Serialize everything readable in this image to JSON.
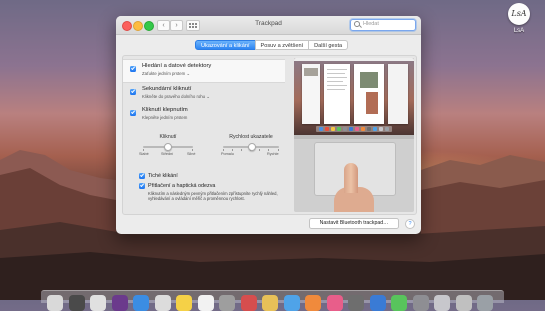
{
  "desktop": {
    "user_name": "LsA",
    "user_avatar_text": "LsA"
  },
  "window": {
    "title": "Trackpad",
    "back_glyph": "‹",
    "forward_glyph": "›",
    "search_placeholder": "Hledat"
  },
  "tabs": [
    {
      "label": "Ukazování a klikání",
      "active": true
    },
    {
      "label": "Posuv a zvětšení",
      "active": false
    },
    {
      "label": "Další gesta",
      "active": false
    }
  ],
  "options": [
    {
      "title": "Hledání a datové detektory",
      "subtitle": "Zaťukte jedním prstem ⌄",
      "checked": true,
      "selected": true
    },
    {
      "title": "Sekundární kliknutí",
      "subtitle": "Klikněte do pravého dolního rohu ⌄",
      "checked": true,
      "selected": false
    },
    {
      "title": "Kliknutí klepnutím",
      "subtitle": "Klepněte jedním prstem",
      "checked": true,
      "selected": false
    }
  ],
  "sliders": {
    "click": {
      "label": "Kliknutí",
      "ticks": [
        "Slabé",
        "Střední",
        "Silné"
      ],
      "value_step": 1
    },
    "speed": {
      "label": "Rychlost ukazatele",
      "ends": [
        "Pomalu",
        "Rychle"
      ],
      "value_fraction": 0.5
    }
  },
  "checkboxes": [
    {
      "label": "Tiché klikání",
      "checked": true
    },
    {
      "label": "Přitlačení a haptická odezva",
      "checked": true
    }
  ],
  "force_click_note": "Kliknutím a následným pevným přitlačením zpřístupníte rychlý náhled, vyhledávání a ovládání měřič a proměnnou rychlost.",
  "bluetooth_button": "Nastavit Bluetooth trackpad…",
  "help_glyph": "?",
  "dock_icon_colors": [
    "#d9d9d9",
    "#4a4a4a",
    "#e0e0e0",
    "#6b3a8c",
    "#3b8de3",
    "#dcdcdc",
    "#f5d147",
    "#f2f2f2",
    "#9e9e9e",
    "#d64e4e",
    "#e8c158",
    "#4fa3e8",
    "#f08a3c",
    "#e85e8a",
    "#6e6e6e",
    "#3a7bd5",
    "#58c45c",
    "#8e8e93",
    "#c7c7cc",
    "#c0c0c0",
    "#9aa0a6"
  ]
}
